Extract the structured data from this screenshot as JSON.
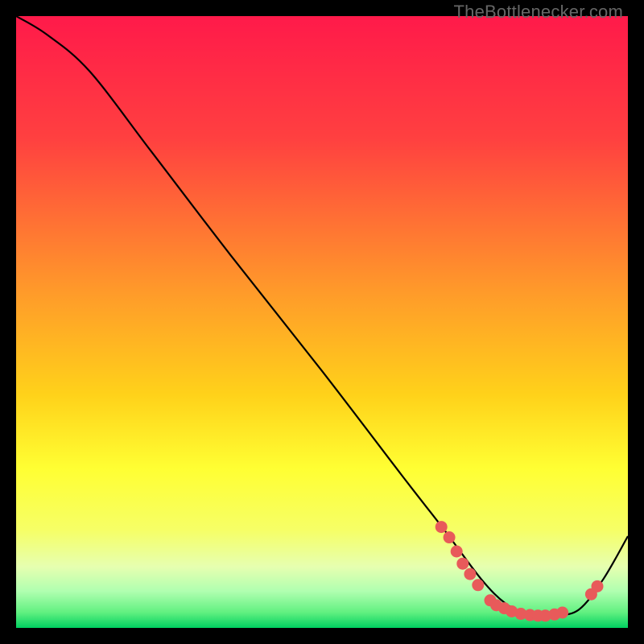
{
  "watermark": "TheBottlenecker.com",
  "chart_data": {
    "type": "line",
    "title": "",
    "xlabel": "",
    "ylabel": "",
    "xlim": [
      0,
      100
    ],
    "ylim": [
      0,
      100
    ],
    "background_gradient": {
      "stops": [
        {
          "offset": 0.0,
          "color": "#ff1a4a"
        },
        {
          "offset": 0.2,
          "color": "#ff4040"
        },
        {
          "offset": 0.45,
          "color": "#ff9a2a"
        },
        {
          "offset": 0.62,
          "color": "#ffd21a"
        },
        {
          "offset": 0.74,
          "color": "#ffff33"
        },
        {
          "offset": 0.84,
          "color": "#f6ff66"
        },
        {
          "offset": 0.9,
          "color": "#e6ffb0"
        },
        {
          "offset": 0.94,
          "color": "#b0ffb0"
        },
        {
          "offset": 0.975,
          "color": "#60f080"
        },
        {
          "offset": 1.0,
          "color": "#00d060"
        }
      ]
    },
    "curve": {
      "x": [
        0,
        5,
        12,
        22,
        35,
        50,
        63,
        70,
        76,
        80,
        84,
        88,
        92,
        96,
        100
      ],
      "y": [
        100,
        97,
        91,
        78,
        61,
        42,
        25,
        16,
        8,
        4,
        2,
        2,
        3,
        8,
        15
      ]
    },
    "scatter_points": [
      {
        "x": 69.5,
        "y": 16.5
      },
      {
        "x": 70.8,
        "y": 14.8
      },
      {
        "x": 72.0,
        "y": 12.5
      },
      {
        "x": 73.0,
        "y": 10.5
      },
      {
        "x": 74.2,
        "y": 8.8
      },
      {
        "x": 75.5,
        "y": 7.0
      },
      {
        "x": 77.5,
        "y": 4.5
      },
      {
        "x": 78.5,
        "y": 3.7
      },
      {
        "x": 79.8,
        "y": 3.2
      },
      {
        "x": 81.0,
        "y": 2.7
      },
      {
        "x": 82.5,
        "y": 2.3
      },
      {
        "x": 84.0,
        "y": 2.1
      },
      {
        "x": 85.3,
        "y": 2.0
      },
      {
        "x": 86.5,
        "y": 2.0
      },
      {
        "x": 88.0,
        "y": 2.2
      },
      {
        "x": 89.3,
        "y": 2.5
      },
      {
        "x": 94.0,
        "y": 5.5
      },
      {
        "x": 95.0,
        "y": 6.8
      }
    ],
    "marker_color": "#e85a5a",
    "curve_color": "#000000"
  }
}
